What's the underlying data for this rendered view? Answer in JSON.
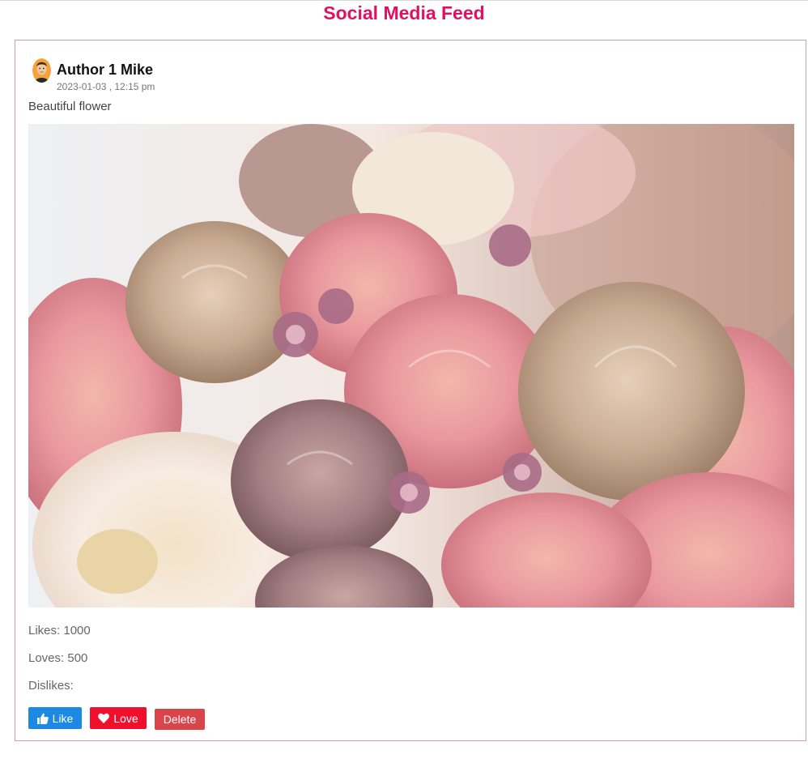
{
  "page": {
    "title": "Social Media Feed"
  },
  "post": {
    "author": "Author 1 Mike",
    "date": "2023-01-03 , 12:15 pm",
    "text": "Beautiful flower",
    "image_subject": "bouquet of pink, cream and mauve roses",
    "stats": {
      "likes": "Likes: 1000",
      "loves": "Loves: 500",
      "dislikes": "Dislikes:"
    },
    "actions": {
      "like_label": "Like",
      "love_label": "Love",
      "delete_label": "Delete"
    }
  },
  "colors": {
    "title": "#e0115f",
    "like_button": "#1e88e5",
    "love_button": "#f0102e",
    "delete_button": "#d9454b",
    "card_border": "#c7a2ad"
  },
  "icons": {
    "like": "thumbs-up-icon",
    "love": "heart-icon",
    "avatar": "avatar-icon"
  }
}
